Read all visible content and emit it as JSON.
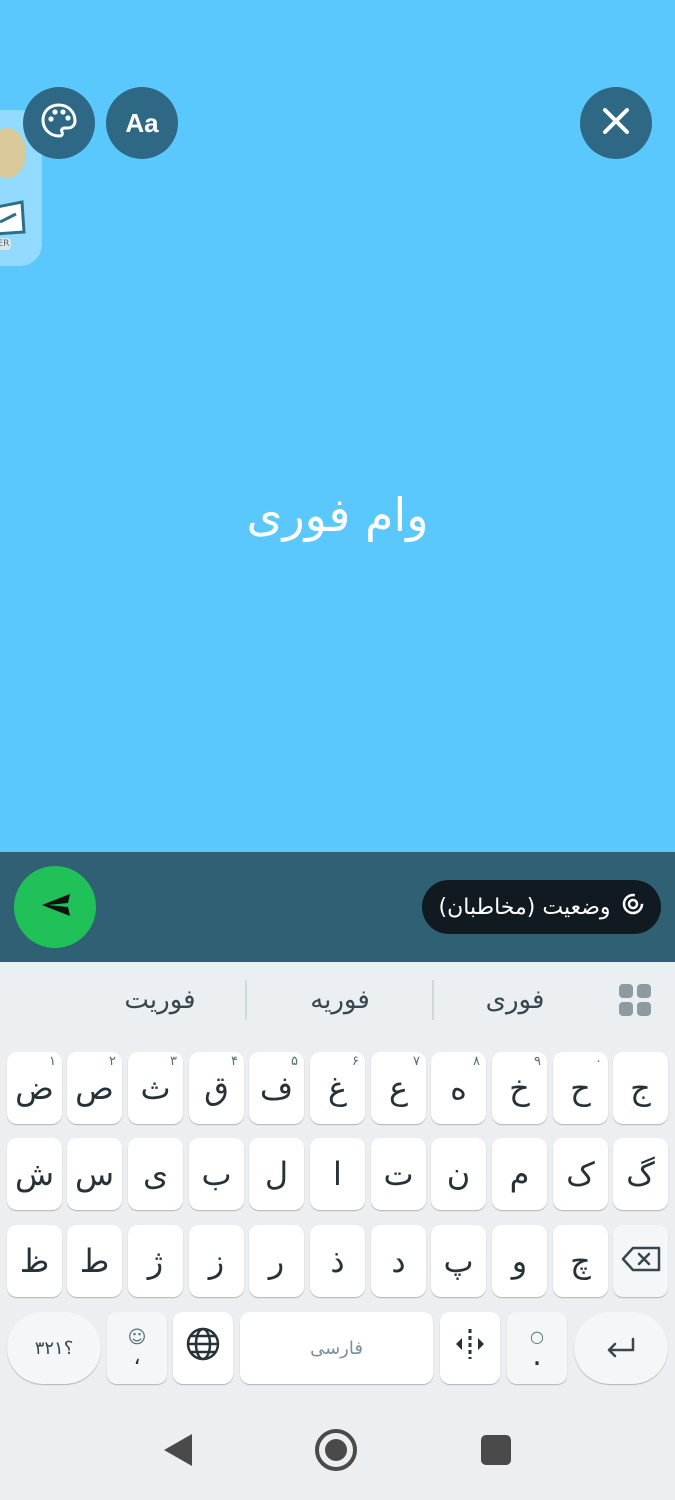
{
  "status_editor": {
    "text": "وام فوری",
    "background_color": "#5ac8fd",
    "buttons": {
      "close_icon": "close-icon",
      "font_label": "Aa",
      "color_icon": "palette-icon"
    },
    "side_tray": {
      "items": [
        "sticker-icon",
        "app-icon"
      ],
      "label": "PER"
    }
  },
  "bottom_bar": {
    "audience_label": "وضعیت (مخاطبان)",
    "send_icon": "send-icon"
  },
  "keyboard": {
    "suggestions": [
      "فوری",
      "فوریه",
      "فوریت"
    ],
    "row1": [
      {
        "char": "ج",
        "hint": ""
      },
      {
        "char": "ح",
        "hint": "٠"
      },
      {
        "char": "خ",
        "hint": "٩"
      },
      {
        "char": "ه",
        "hint": "٨"
      },
      {
        "char": "ع",
        "hint": "٧"
      },
      {
        "char": "غ",
        "hint": "۶"
      },
      {
        "char": "ف",
        "hint": "۵"
      },
      {
        "char": "ق",
        "hint": "۴"
      },
      {
        "char": "ث",
        "hint": "٣"
      },
      {
        "char": "ص",
        "hint": "٢"
      },
      {
        "char": "ض",
        "hint": "١"
      }
    ],
    "row2": [
      "گ",
      "ک",
      "م",
      "ن",
      "ت",
      "ا",
      "ل",
      "ب",
      "ی",
      "س",
      "ش"
    ],
    "row3": [
      "چ",
      "و",
      "پ",
      "د",
      "ذ",
      "ر",
      "ز",
      "ژ",
      "ط",
      "ظ"
    ],
    "bottom": {
      "numbers_label": "؟۳۲۱",
      "comma": "،",
      "space_label": "فارسی",
      "period": "."
    }
  }
}
